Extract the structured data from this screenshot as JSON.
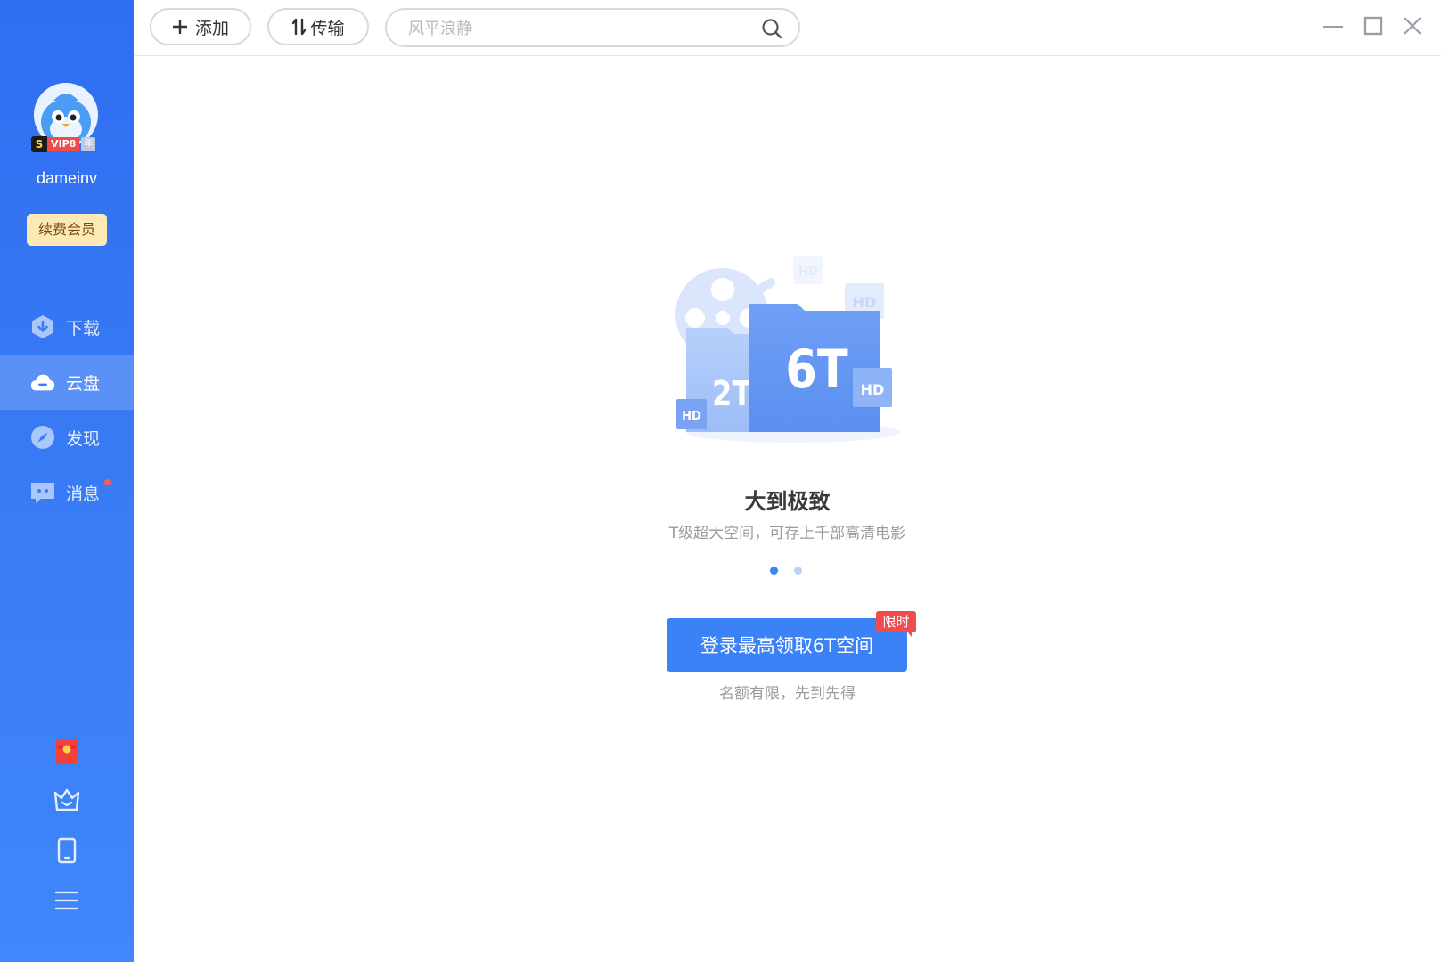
{
  "sidebar": {
    "username": "dameinv",
    "vip": {
      "s": "S",
      "tag": "VIP8",
      "year": "年"
    },
    "renew_label": "续费会员",
    "nav": [
      {
        "label": "下载",
        "icon": "download-icon"
      },
      {
        "label": "云盘",
        "icon": "cloud-icon",
        "active": true
      },
      {
        "label": "发现",
        "icon": "compass-icon"
      },
      {
        "label": "消息",
        "icon": "message-icon",
        "unread_dot": true
      }
    ],
    "tools": [
      "red-envelope-icon",
      "crown-icon",
      "tablet-icon",
      "menu-icon"
    ]
  },
  "toolbar": {
    "add_label": "添加",
    "transfer_label": "传输",
    "search_placeholder": "风平浪静"
  },
  "illustration": {
    "big_folder_label": "6T",
    "small_folder_label": "2T",
    "hd_tag": "HD"
  },
  "main": {
    "headline": "大到极致",
    "subline": "T级超大空间，可存上千部高清电影",
    "carousel": {
      "count": 2,
      "active_index": 0
    },
    "cta_label": "登录最高领取6T空间",
    "badge": "限时",
    "note": "名额有限，先到先得"
  },
  "colors": {
    "sidebar": "#3a7cf5",
    "accent": "#3b82f6",
    "badge": "#ef4d4d",
    "renew_bg": "#fde9b4"
  }
}
